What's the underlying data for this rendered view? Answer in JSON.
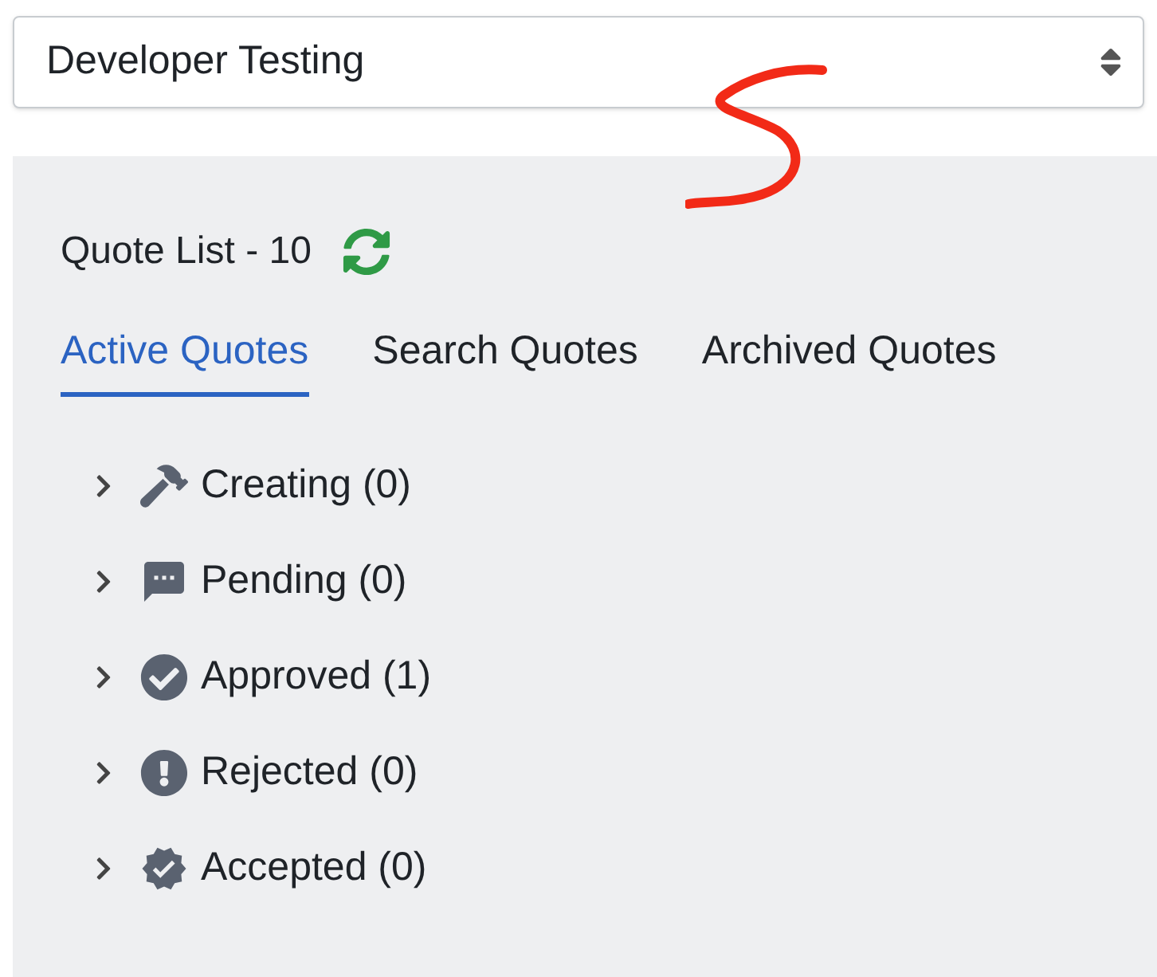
{
  "selector": {
    "value": "Developer Testing"
  },
  "annotation": {
    "kind": "scribble"
  },
  "quote_list": {
    "title": "Quote List - 10"
  },
  "tabs": [
    {
      "label": "Active Quotes",
      "selected": true
    },
    {
      "label": "Search Quotes",
      "selected": false
    },
    {
      "label": "Archived Quotes",
      "selected": false
    }
  ],
  "groups": [
    {
      "label": "Creating (0)",
      "kind": "hammer",
      "expanded": false
    },
    {
      "label": "Pending (0)",
      "kind": "comment",
      "expanded": false
    },
    {
      "label": "Approved (1)",
      "kind": "check",
      "expanded": false
    },
    {
      "label": "Rejected (0)",
      "kind": "exclamation",
      "expanded": false
    },
    {
      "label": "Accepted (0)",
      "kind": "badge",
      "expanded": false
    }
  ]
}
